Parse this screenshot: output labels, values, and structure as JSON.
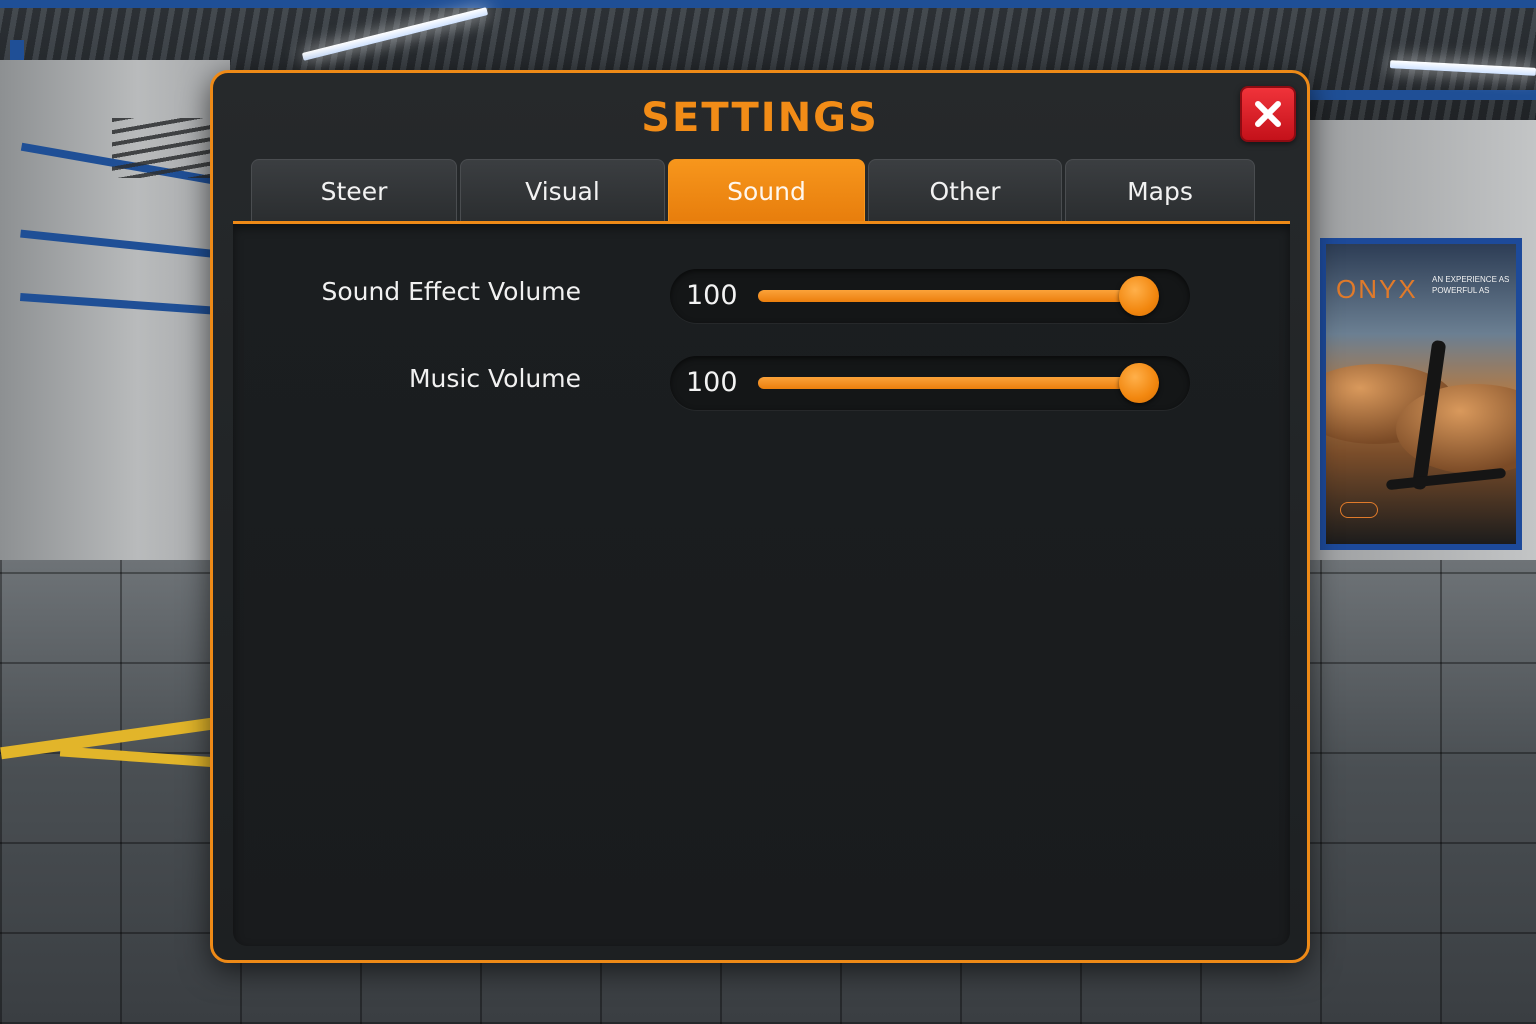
{
  "dialog": {
    "title": "SETTINGS",
    "close_icon": "close-x-icon"
  },
  "tabs": [
    {
      "label": "Steer",
      "active": false
    },
    {
      "label": "Visual",
      "active": false
    },
    {
      "label": "Sound",
      "active": true
    },
    {
      "label": "Other",
      "active": false
    },
    {
      "label": "Maps",
      "active": false
    }
  ],
  "sound": {
    "sliders": [
      {
        "label": "Sound Effect Volume",
        "value": "100",
        "level": 1.0
      },
      {
        "label": "Music Volume",
        "value": "100",
        "level": 1.0
      }
    ]
  },
  "background": {
    "poster_brand": "ONYX",
    "poster_tagline": "AN EXPERIENCE AS POWERFUL AS"
  },
  "colors": {
    "accent": "#ee8a17",
    "close": "#d81f26",
    "panel": "#1d2022"
  }
}
